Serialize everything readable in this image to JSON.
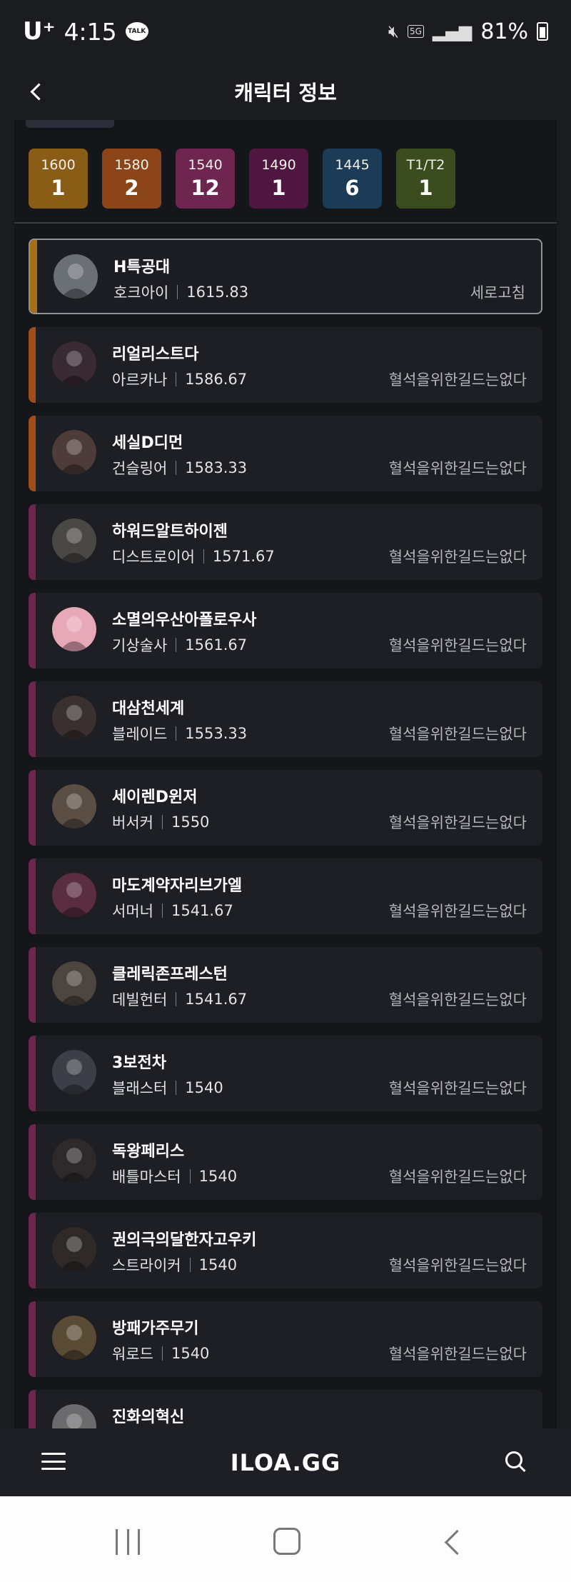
{
  "status_bar": {
    "carrier": "U⁺",
    "time": "4:15",
    "talk": "TALK",
    "network": "5G",
    "battery": "81%"
  },
  "header": {
    "title": "캐릭터 정보"
  },
  "tiers": [
    {
      "level": "1600",
      "count": "1",
      "color": "#8a5d17"
    },
    {
      "level": "1580",
      "count": "2",
      "color": "#8b4518"
    },
    {
      "level": "1540",
      "count": "12",
      "color": "#6e2650"
    },
    {
      "level": "1490",
      "count": "1",
      "color": "#4f1740"
    },
    {
      "level": "1445",
      "count": "6",
      "color": "#1b3b57"
    },
    {
      "level": "T1/T2",
      "count": "1",
      "color": "#3b4d1f"
    }
  ],
  "characters": [
    {
      "name": "H특공대",
      "class": "호크아이",
      "item_level": "1615.83",
      "right": "세로고침",
      "accent": "#a56f18",
      "avatar": "#6b6f76",
      "selected": true
    },
    {
      "name": "리얼리스트다",
      "class": "아르카나",
      "item_level": "1586.67",
      "right": "혈석을위한길드는없다",
      "accent": "#a04d18",
      "avatar": "#3a2a33"
    },
    {
      "name": "세실D디먼",
      "class": "건슬링어",
      "item_level": "1583.33",
      "right": "혈석을위한길드는없다",
      "accent": "#a04d18",
      "avatar": "#4e3c3a"
    },
    {
      "name": "하워드알트하이젠",
      "class": "디스트로이어",
      "item_level": "1571.67",
      "right": "혈석을위한길드는없다",
      "accent": "#6e2650",
      "avatar": "#4a4845"
    },
    {
      "name": "소멸의우산아폴로우사",
      "class": "기상술사",
      "item_level": "1561.67",
      "right": "혈석을위한길드는없다",
      "accent": "#6e2650",
      "avatar": "#e7a8b8"
    },
    {
      "name": "대삼천세계",
      "class": "블레이드",
      "item_level": "1553.33",
      "right": "혈석을위한길드는없다",
      "accent": "#6e2650",
      "avatar": "#3b3030"
    },
    {
      "name": "세이렌D윈저",
      "class": "버서커",
      "item_level": "1550",
      "right": "혈석을위한길드는없다",
      "accent": "#6e2650",
      "avatar": "#5b4f45"
    },
    {
      "name": "마도계약자리브가엘",
      "class": "서머너",
      "item_level": "1541.67",
      "right": "혈석을위한길드는없다",
      "accent": "#6e2650",
      "avatar": "#5a2d40"
    },
    {
      "name": "클레릭존프레스턴",
      "class": "데빌헌터",
      "item_level": "1541.67",
      "right": "혈석을위한길드는없다",
      "accent": "#6e2650",
      "avatar": "#4d4640"
    },
    {
      "name": "3보전차",
      "class": "블래스터",
      "item_level": "1540",
      "right": "혈석을위한길드는없다",
      "accent": "#6e2650",
      "avatar": "#3c3f48"
    },
    {
      "name": "독왕페리스",
      "class": "배틀마스터",
      "item_level": "1540",
      "right": "혈석을위한길드는없다",
      "accent": "#6e2650",
      "avatar": "#2e2a2c"
    },
    {
      "name": "권의극의달한자고우키",
      "class": "스트라이커",
      "item_level": "1540",
      "right": "혈석을위한길드는없다",
      "accent": "#6e2650",
      "avatar": "#2f2a28"
    },
    {
      "name": "방패가주무기",
      "class": "워로드",
      "item_level": "1540",
      "right": "혈석을위한길드는없다",
      "accent": "#6e2650",
      "avatar": "#5a4b35"
    },
    {
      "name": "진화의혁신",
      "class": "",
      "item_level": "",
      "right": "",
      "accent": "#6e2650",
      "avatar": "#6b6a6c"
    }
  ],
  "bottom_bar": {
    "brand": "ILOA.GG"
  }
}
